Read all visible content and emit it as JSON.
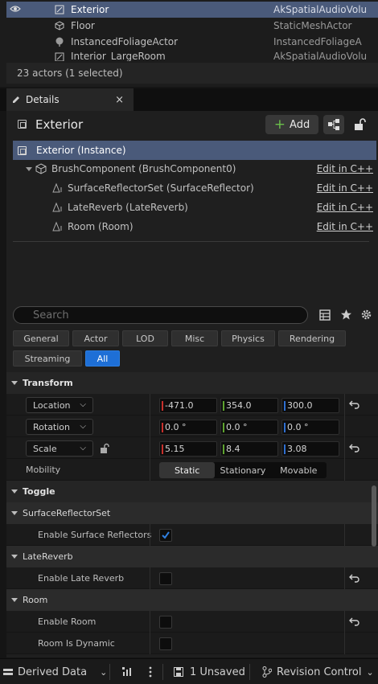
{
  "outliner": {
    "rows": [
      {
        "name": "Exterior",
        "type": "AkSpatialAudioVolu",
        "selected": true,
        "visible": true
      },
      {
        "name": "Floor",
        "type": "StaticMeshActor",
        "selected": false,
        "visible": false
      },
      {
        "name": "InstancedFoliageActor",
        "type": "InstancedFoliageA",
        "selected": false,
        "visible": false
      },
      {
        "name": "Interior_LargeRoom",
        "type": "AkSpatialAudioVolu",
        "selected": false,
        "visible": false
      }
    ],
    "status": "23 actors (1 selected)"
  },
  "details": {
    "tab_label": "Details",
    "close_glyph": "×",
    "actor_name": "Exterior",
    "add_label": "Add",
    "components": [
      {
        "label": "Exterior (Instance)",
        "edit": ""
      },
      {
        "label": "BrushComponent (BrushComponent0)",
        "edit": "Edit in C++"
      },
      {
        "label": "SurfaceReflectorSet (SurfaceReflector)",
        "edit": "Edit in C++"
      },
      {
        "label": "LateReverb (LateReverb)",
        "edit": "Edit in C++"
      },
      {
        "label": "Room (Room)",
        "edit": "Edit in C++"
      }
    ],
    "search_placeholder": "Search",
    "filters": [
      "General",
      "Actor",
      "LOD",
      "Misc",
      "Physics",
      "Rendering",
      "Streaming",
      "All"
    ],
    "active_filter": "All"
  },
  "transform": {
    "section": "Transform",
    "location": {
      "label": "Location",
      "x": "-471.0",
      "y": "354.0",
      "z": "300.0"
    },
    "rotation": {
      "label": "Rotation",
      "x": "0.0 °",
      "y": "0.0 °",
      "z": "0.0 °"
    },
    "scale": {
      "label": "Scale",
      "x": "5.15",
      "y": "8.4",
      "z": "3.08"
    },
    "mobility": {
      "label": "Mobility",
      "options": [
        "Static",
        "Stationary",
        "Movable"
      ],
      "selected": "Static"
    }
  },
  "toggle": {
    "section": "Toggle",
    "groups": {
      "surface": {
        "label": "SurfaceReflectorSet",
        "prop": "Enable Surface Reflectors",
        "checked": true
      },
      "late": {
        "label": "LateReverb",
        "prop": "Enable Late Reverb",
        "checked": false
      },
      "room": {
        "label": "Room",
        "prop1": "Enable Room",
        "prop2": "Room Is Dynamic",
        "checked1": false,
        "checked2": false
      }
    }
  },
  "statusbar": {
    "derived": "Derived Data",
    "unsaved": "1 Unsaved",
    "revision": "Revision Control"
  },
  "colors": {
    "accent": "#1e6fd6",
    "selection": "#4a5a7a",
    "x_axis": "#c8302c",
    "y_axis": "#5ea32f",
    "z_axis": "#2f6fd0",
    "plus": "#6bbf4b"
  }
}
